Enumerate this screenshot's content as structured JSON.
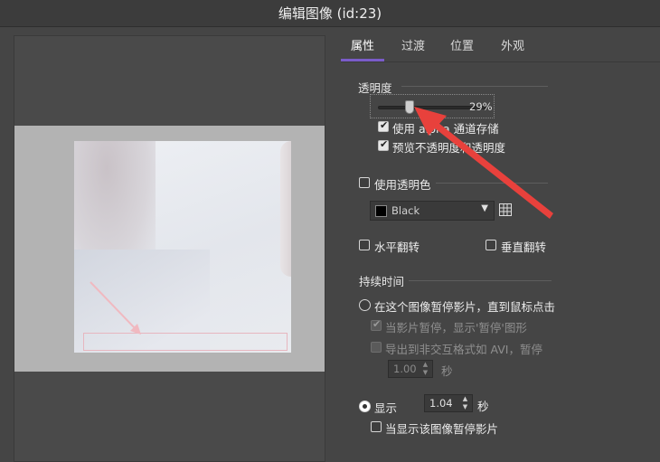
{
  "window": {
    "title": "编辑图像 (id:23)"
  },
  "tabs": [
    {
      "label": "属性",
      "active": true
    },
    {
      "label": "过渡",
      "active": false
    },
    {
      "label": "位置",
      "active": false
    },
    {
      "label": "外观",
      "active": false
    }
  ],
  "opacity": {
    "section_label": "透明度",
    "value_text": "29%",
    "value": 0.29,
    "use_alpha": {
      "label": "使用 alpha 通道存储",
      "checked": true
    },
    "preview_opaque": {
      "label": "预览不透明度和透明度",
      "checked": true
    }
  },
  "transparent_color": {
    "label": "使用透明色",
    "checked": false,
    "color_select": "Black",
    "color_hex": "#000000"
  },
  "flip": {
    "horizontal": {
      "label": "水平翻转",
      "checked": false
    },
    "vertical": {
      "label": "垂直翻转",
      "checked": false
    }
  },
  "duration": {
    "section_label": "持续时间",
    "pause_option": {
      "label": "在这个图像暂停影片，直到鼠标点击",
      "selected": false
    },
    "pause_show_graphic": {
      "label": "当影片暂停，显示'暂停'图形",
      "checked": true,
      "disabled": true
    },
    "export_pause": {
      "label": "导出到非交互格式如 AVI，暂停",
      "checked": false,
      "disabled": true
    },
    "export_seconds": "1.00",
    "export_unit": "秒",
    "show_option": {
      "label": "显示",
      "selected": true
    },
    "show_seconds": "1.04",
    "show_unit": "秒",
    "pause_while_shown": {
      "label": "当显示该图像暂停影片",
      "checked": false
    }
  },
  "colors": {
    "accent": "#7a5cc9",
    "annotation_arrow": "#e8413c"
  }
}
